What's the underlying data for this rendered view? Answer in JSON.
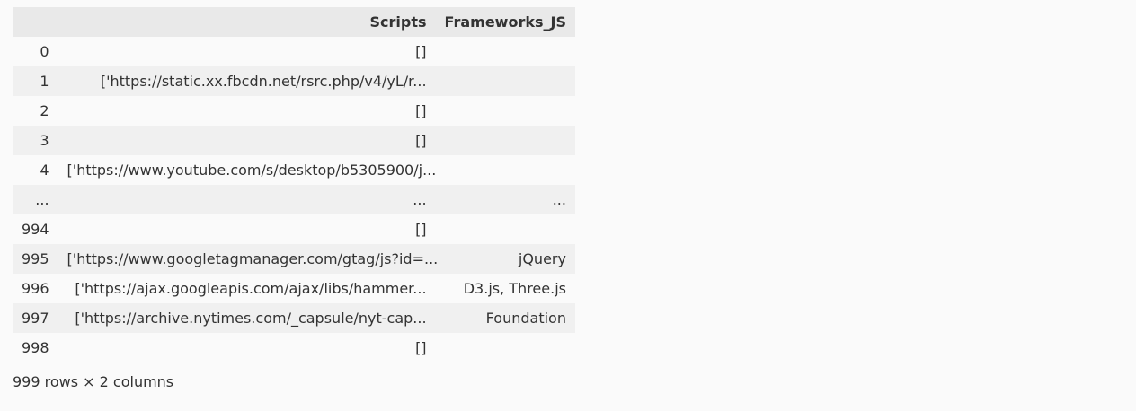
{
  "table": {
    "columns": [
      "",
      "Scripts",
      "Frameworks_JS"
    ],
    "rows": [
      {
        "index": "0",
        "scripts": "[]",
        "frameworks": ""
      },
      {
        "index": "1",
        "scripts": "['https://static.xx.fbcdn.net/rsrc.php/v4/yL/r...",
        "frameworks": ""
      },
      {
        "index": "2",
        "scripts": "[]",
        "frameworks": ""
      },
      {
        "index": "3",
        "scripts": "[]",
        "frameworks": ""
      },
      {
        "index": "4",
        "scripts": "['https://www.youtube.com/s/desktop/b5305900/j...",
        "frameworks": ""
      },
      {
        "index": "...",
        "scripts": "...",
        "frameworks": "..."
      },
      {
        "index": "994",
        "scripts": "[]",
        "frameworks": ""
      },
      {
        "index": "995",
        "scripts": "['https://www.googletagmanager.com/gtag/js?id=...",
        "frameworks": "jQuery"
      },
      {
        "index": "996",
        "scripts": "['https://ajax.googleapis.com/ajax/libs/hammer...",
        "frameworks": "D3.js, Three.js"
      },
      {
        "index": "997",
        "scripts": "['https://archive.nytimes.com/_capsule/nyt-cap...",
        "frameworks": "Foundation"
      },
      {
        "index": "998",
        "scripts": "[]",
        "frameworks": ""
      }
    ]
  },
  "shape_text": "999 rows × 2 columns"
}
